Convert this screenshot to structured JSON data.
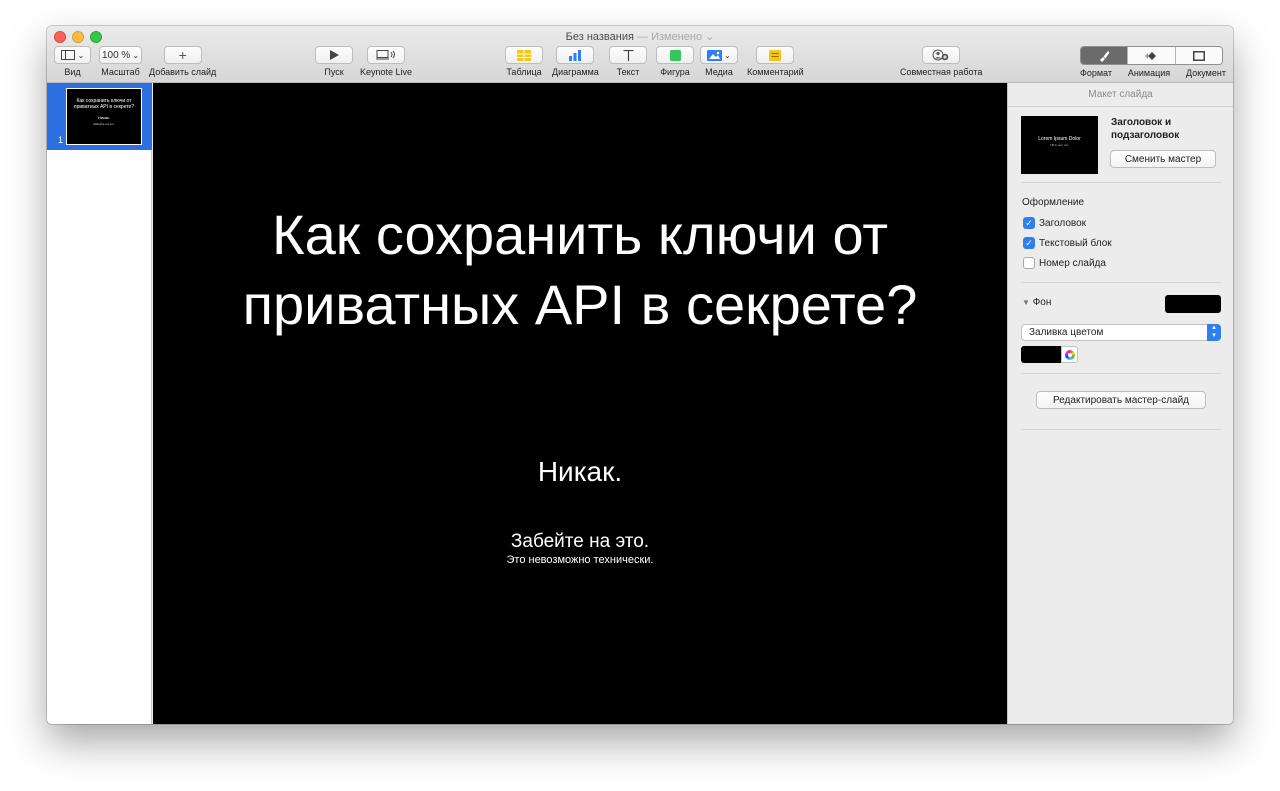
{
  "window": {
    "title": "Без названия",
    "title_separator": "—",
    "edited_status": "Изменено"
  },
  "toolbar": {
    "view_label": "Вид",
    "zoom_value": "100 %",
    "zoom_label": "Масштаб",
    "add_slide_label": "Добавить слайд",
    "play_label": "Пуск",
    "keynote_live_label": "Keynote Live",
    "table_label": "Таблица",
    "chart_label": "Диаграмма",
    "text_label": "Текст",
    "shape_label": "Фигура",
    "media_label": "Медиа",
    "comment_label": "Комментарий",
    "collaborate_label": "Совместная работа",
    "format_label": "Формат",
    "animate_label": "Анимация",
    "document_label": "Документ"
  },
  "navigator": {
    "slides": [
      {
        "number": "1",
        "title": "Как сохранить ключи от приватных API в секрете?",
        "subtitle": "Никак.",
        "body": "Забейте на это."
      }
    ]
  },
  "slide": {
    "title": "Как сохранить ключи от приватных API в секрете?",
    "subtitle": "Никак.",
    "body_line1": "Забейте на это.",
    "body_line2": "Это невозможно технически."
  },
  "inspector": {
    "header": "Макет слайда",
    "master_thumb_title": "Lorem Ipsum Dolor",
    "master_thumb_sub": "Nibh sem nec",
    "master_name": "Заголовок и подзаголовок",
    "change_master_button": "Сменить мастер",
    "appearance_title": "Оформление",
    "checkboxes": [
      {
        "label": "Заголовок",
        "checked": true
      },
      {
        "label": "Текстовый блок",
        "checked": true
      },
      {
        "label": "Номер слайда",
        "checked": false
      }
    ],
    "background_title": "Фон",
    "fill_type": "Заливка цветом",
    "background_color": "#000000",
    "edit_master_button": "Редактировать мастер-слайд"
  },
  "colors": {
    "accent": "#2e80f0",
    "selection": "#2b6fe0",
    "slide_bg": "#000000"
  }
}
